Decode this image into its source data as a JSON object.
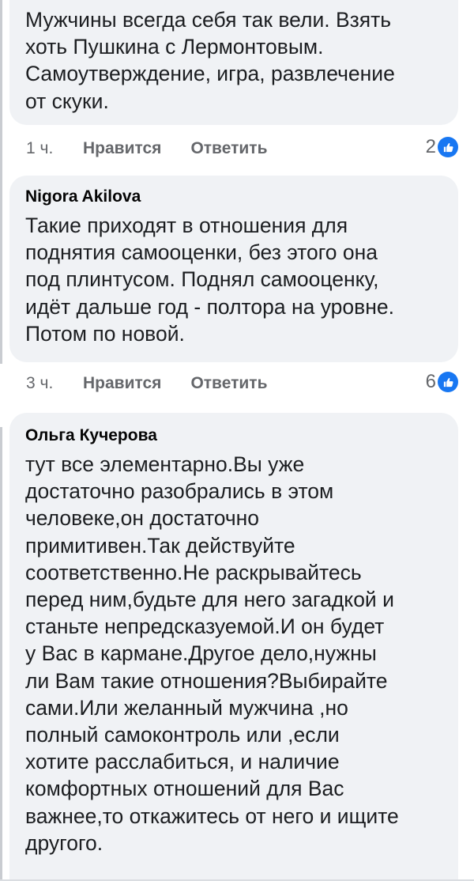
{
  "comments": [
    {
      "author": "",
      "text": "Мужчины всегда себя так вели. Взять\nхоть Пушкина с Лермонтовым.\nСамоутверждение, игра, развлечение\nот скуки.",
      "time": "1 ч.",
      "like_label": "Нравится",
      "reply_label": "Ответить",
      "reaction_count": "2"
    },
    {
      "author": "Nigora Akilova",
      "text": "Такие приходят в отношения для\nподнятия самооценки, без этого она\nпод плинтусом. Поднял самооценку,\nидёт дальше год - полтора на уровне.\nПотом по новой.",
      "time": "3 ч.",
      "like_label": "Нравится",
      "reply_label": "Ответить",
      "reaction_count": "6"
    },
    {
      "author": "Ольга Кучерова",
      "text": "тут все элементарно.Вы уже\nдостаточно разобрались в этом\nчеловеке,он достаточно\nпримитивен.Так  действуйте\nсоответственно.Не раскрывайтесь\nперед ним,будьте для него загадкой и\nстаньте непредсказуемой.И он будет\nу Вас  в кармане.Другое дело,нужны\nли Вам такие отношения?Выбирайте\nсами.Или желанный мужчина  ,но\nполный самоконтроль или ,если\nхотите расслабиться, и наличие\nкомфортных отношений для Вас\nважнее,то откажитесь от него и ищите\nдругого."
    }
  ],
  "colors": {
    "bubble_bg": "#f0f2f5",
    "like_blue": "#1877f2",
    "meta_gray": "#65676b",
    "text": "#1c1e21"
  },
  "icons": {
    "reaction": "like-thumbs-up-icon"
  }
}
